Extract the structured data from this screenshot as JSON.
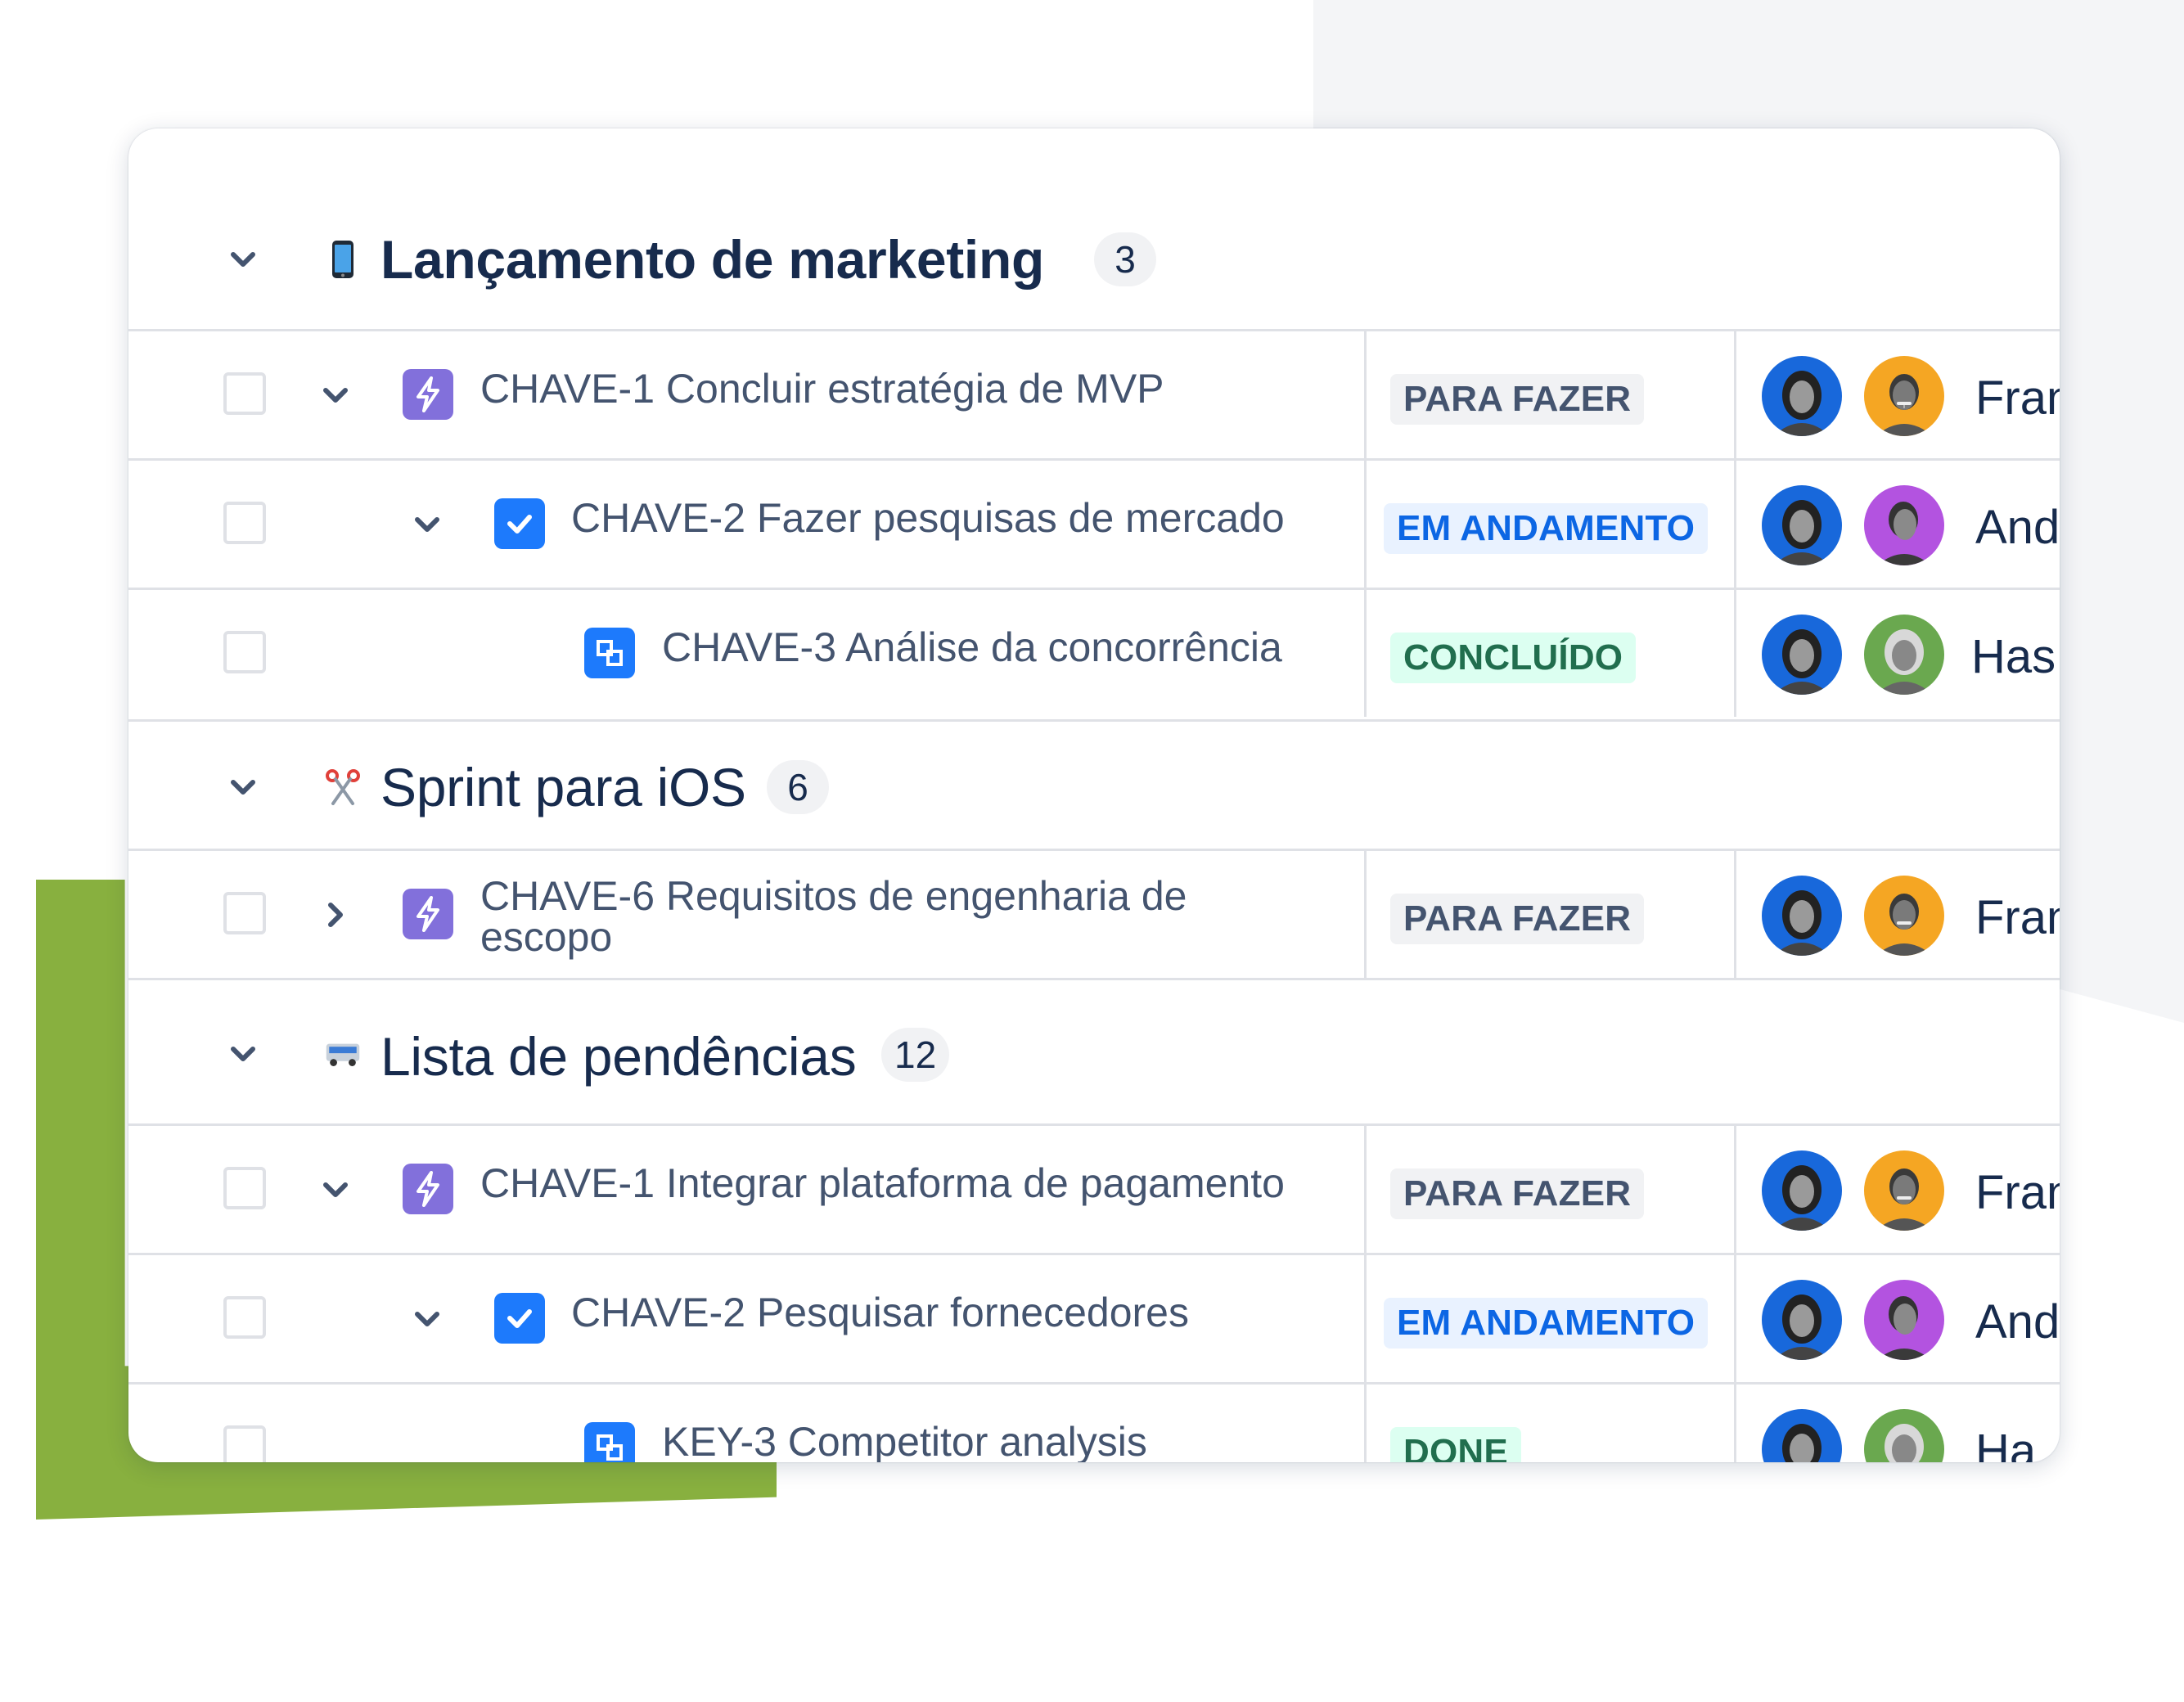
{
  "groups": [
    {
      "title": "Lançamento de marketing",
      "count": "3",
      "icon": "mobile-phone-icon",
      "rows": [
        {
          "key_summary": "CHAVE-1 Concluir estratégia de MVP",
          "type": "story",
          "status": "PARA FAZER",
          "status_kind": "todo",
          "assignee": "Fran",
          "expand": "down",
          "avatar2": "orange"
        },
        {
          "key_summary": "CHAVE-2 Fazer pesquisas de mercado",
          "type": "task",
          "status": "EM ANDAMENTO",
          "status_kind": "progress",
          "assignee": "And",
          "expand": "down",
          "avatar2": "purple"
        },
        {
          "key_summary": "CHAVE-3 Análise da concorrência",
          "type": "subtask",
          "status": "CONCLUÍDO",
          "status_kind": "done",
          "assignee": "Has",
          "expand": "none",
          "avatar2": "green"
        }
      ]
    },
    {
      "title": "Sprint para iOS",
      "count": "6",
      "icon": "scissors-icon",
      "rows": [
        {
          "key_summary": "CHAVE-6 Requisitos de engenharia de escopo",
          "type": "story",
          "status": "PARA FAZER",
          "status_kind": "todo",
          "assignee": "Fran",
          "expand": "right",
          "avatar2": "orange"
        }
      ]
    },
    {
      "title": "Lista de pendências",
      "count": "12",
      "icon": "bus-icon",
      "rows": [
        {
          "key_summary": "CHAVE-1 Integrar plataforma de pagamento",
          "type": "story",
          "status": "PARA FAZER",
          "status_kind": "todo",
          "assignee": "Fran",
          "expand": "down",
          "avatar2": "orange"
        },
        {
          "key_summary": "CHAVE-2 Pesquisar fornecedores",
          "type": "task",
          "status": "EM ANDAMENTO",
          "status_kind": "progress",
          "assignee": "And",
          "expand": "down",
          "avatar2": "purple"
        },
        {
          "key_summary": "KEY-3 Competitor analysis",
          "type": "subtask",
          "status": "DONE",
          "status_kind": "done",
          "assignee": "Ha",
          "expand": "none",
          "avatar2": "green"
        }
      ]
    }
  ],
  "colors": {
    "accent_green": "#88b03f",
    "todo_bg": "#f1f2f4",
    "progress_text": "#0c66e4",
    "done_text": "#216e4e",
    "story_icon": "#8270db",
    "task_icon": "#1d7afc"
  }
}
